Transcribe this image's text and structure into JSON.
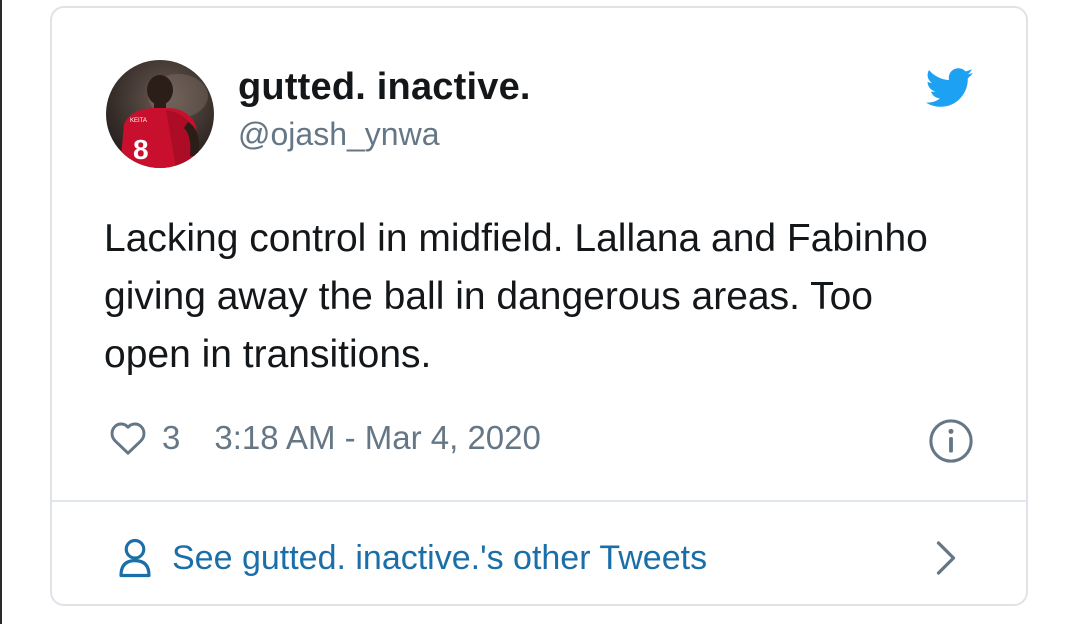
{
  "tweet": {
    "display_name": "gutted. inactive.",
    "handle": "@ojash_ynwa",
    "text": "Lacking control in midfield. Lallana and Fabinho giving away the ball in dangerous areas. Too open in transitions.",
    "like_count": "3",
    "timestamp": "3:18 AM - Mar 4, 2020",
    "avatar_jersey_number": "8",
    "avatar_jersey_name": "KEITA"
  },
  "footer": {
    "other_tweets_label": "See gutted. inactive.'s other Tweets"
  },
  "icons": {
    "brand": "twitter-bird-icon",
    "like": "heart-icon",
    "info": "info-icon",
    "profile": "person-icon",
    "expand": "chevron-right-icon"
  },
  "colors": {
    "twitter_blue": "#1da1f2",
    "link_blue": "#1b6fa8",
    "text_primary": "#14171a",
    "text_secondary": "#657786",
    "border": "#dfe3e7"
  }
}
